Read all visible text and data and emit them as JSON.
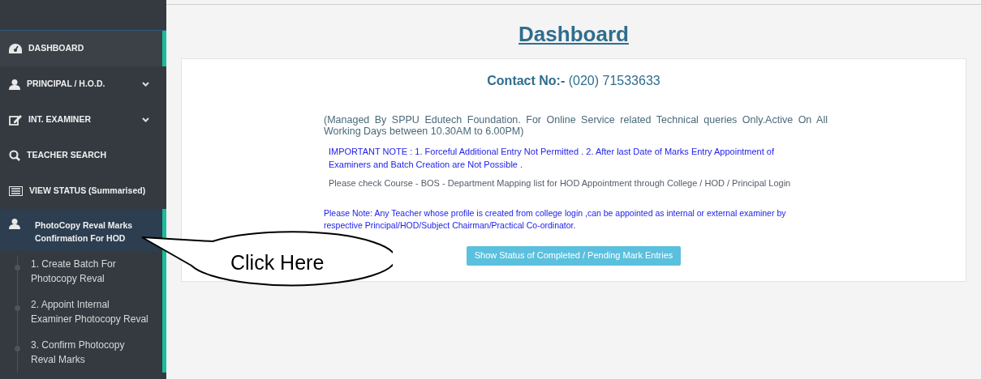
{
  "sidebar": {
    "items": [
      {
        "label": "DASHBOARD",
        "kind": "link",
        "selected": true
      },
      {
        "label": "PRINCIPAL / H.O.D.",
        "kind": "dropdown",
        "selected": false
      },
      {
        "label": "INT. EXAMINER",
        "kind": "dropdown",
        "selected": false
      },
      {
        "label": "TEACHER SEARCH",
        "kind": "link",
        "selected": false
      },
      {
        "label": "VIEW STATUS (Summarised)",
        "kind": "link",
        "selected": false
      },
      {
        "label": "PhotoCopy Reval Marks Confirmation For HOD",
        "kind": "group",
        "selected": true,
        "children": [
          {
            "label": "1. Create Batch For Photocopy Reval"
          },
          {
            "label": "2. Appoint Internal Examiner Photocopy Reval"
          },
          {
            "label": "3. Confirm Photocopy Reval Marks"
          }
        ]
      }
    ]
  },
  "page_title": "Dashboard",
  "card": {
    "contact_label": "Contact No:-",
    "contact_number": "(020) 71533633",
    "managed_note": "(Managed By SPPU Edutech Foundation. For Online Service related Technical queries Only.Active On All Working Days between 10.30AM to 6.00PM)",
    "important_note": "IMPORTANT NOTE : 1. Forceful Additional Entry Not Permitted . 2. After last Date of Marks Entry Appointment of Examiners and Batch Creation are Not Possible .",
    "mapping_note": "Please check Course - BOS - Department Mapping list for HOD Appointment through College / HOD / Principal Login",
    "teacher_note": "Please Note: Any Teacher whose profile is created from college login ,can be appointed as internal or external examiner by respective Principal/HOD/Subject Chairman/Practical Co-ordinator.",
    "status_button": "Show Status of Completed / Pending Mark Entries"
  },
  "callout": {
    "text": "Click Here"
  }
}
